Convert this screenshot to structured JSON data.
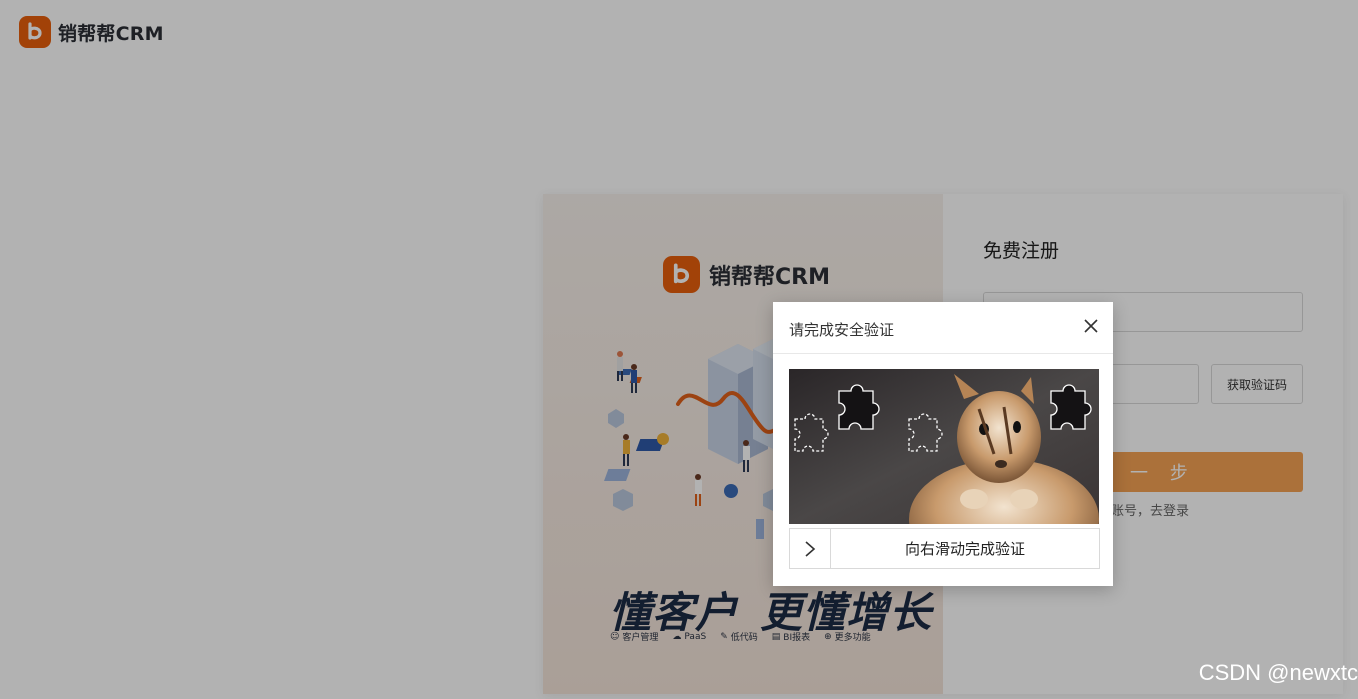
{
  "header": {
    "brand_name": "销帮帮CRM",
    "brand_color": "#e85f0c"
  },
  "promo": {
    "brand_name": "销帮帮CRM",
    "slogan_part1": "懂客户",
    "slogan_part2": "更懂增长",
    "features": [
      {
        "icon": "user-icon",
        "label": "客户管理"
      },
      {
        "icon": "cloud-icon",
        "label": "PaaS"
      },
      {
        "icon": "pencil-icon",
        "label": "低代码"
      },
      {
        "icon": "report-icon",
        "label": "BI报表"
      },
      {
        "icon": "plus-circle-icon",
        "label": "更多功能"
      }
    ]
  },
  "register": {
    "title": "免费注册",
    "phone_placeholder": "",
    "code_placeholder": "",
    "get_code_label": "获取验证码",
    "next_label": "下 一 步",
    "next_color": "#f5a254",
    "login_link_text": "账号，去登录"
  },
  "captcha": {
    "title": "请完成安全验证",
    "close_icon": "close-icon",
    "slider_hint": "向右滑动完成验证",
    "slider_icon": "chevron-right-icon"
  },
  "watermark": "CSDN @newxtc"
}
